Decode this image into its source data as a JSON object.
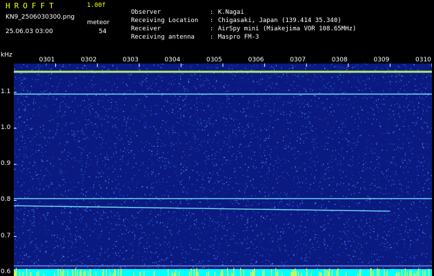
{
  "header": {
    "title": "HROFFT",
    "version": "1.00f",
    "filename": "KN9_2506030300.png",
    "meteor_label": "meteor",
    "datetime": "25.06.03 03:00",
    "meteor_count": "54",
    "info": [
      {
        "key": "Observer",
        "value": "K.Nagai"
      },
      {
        "key": "Receiving Location",
        "value": "Chigasaki, Japan (139.414 35.340)"
      },
      {
        "key": "Receiver",
        "value": "AirSpy mini (Miakejima VOR 108.65MHz)"
      },
      {
        "key": "Receiving antenna",
        "value": "Maspro FM-3"
      }
    ]
  },
  "colors": {
    "background": "#000000",
    "plot_bg": "#0a1a80",
    "noise_dot": "#2a5cff",
    "signal_line": "#7ef0ff",
    "strong_signal": "#c8ff6a",
    "header_text": "#ffff00",
    "bottom_strip": "#00ffff"
  },
  "chart_data": {
    "type": "heatmap",
    "ylabel": "kHz",
    "ylim": [
      0.59,
      1.18
    ],
    "y_ticks": [
      {
        "label": "1.1",
        "value": 1.1
      },
      {
        "label": "1.0",
        "value": 1.0
      },
      {
        "label": "0.9",
        "value": 0.9
      },
      {
        "label": "0.8",
        "value": 0.8
      },
      {
        "label": "0.7",
        "value": 0.7
      },
      {
        "label": "0.6",
        "value": 0.6
      }
    ],
    "xlim": [
      0.0,
      10.0
    ],
    "x_ticks": [
      {
        "label": "0301",
        "value": 1
      },
      {
        "label": "0302",
        "value": 2
      },
      {
        "label": "0303",
        "value": 3
      },
      {
        "label": "0304",
        "value": 4
      },
      {
        "label": "0305",
        "value": 5
      },
      {
        "label": "0306",
        "value": 6
      },
      {
        "label": "0307",
        "value": 7
      },
      {
        "label": "0308",
        "value": 8
      },
      {
        "label": "0309",
        "value": 9
      },
      {
        "label": "0310",
        "value": 10
      }
    ],
    "horizontal_traces": [
      {
        "freq": 1.157,
        "x0": 0.0,
        "x1": 10.0,
        "strength": "strong"
      },
      {
        "freq": 1.095,
        "x0": 0.0,
        "x1": 10.0,
        "strength": "medium"
      },
      {
        "freq": 0.805,
        "x0": 0.0,
        "x1": 10.0,
        "strength": "medium"
      },
      {
        "freq": 0.785,
        "freq_end": 0.77,
        "x0": 0.0,
        "x1": 9.0,
        "strength": "medium"
      },
      {
        "freq": 0.618,
        "x0": 0.0,
        "x1": 10.0,
        "strength": "faint"
      },
      {
        "freq": 0.598,
        "x0": 0.0,
        "x1": 10.0,
        "strength": "faint"
      }
    ]
  }
}
